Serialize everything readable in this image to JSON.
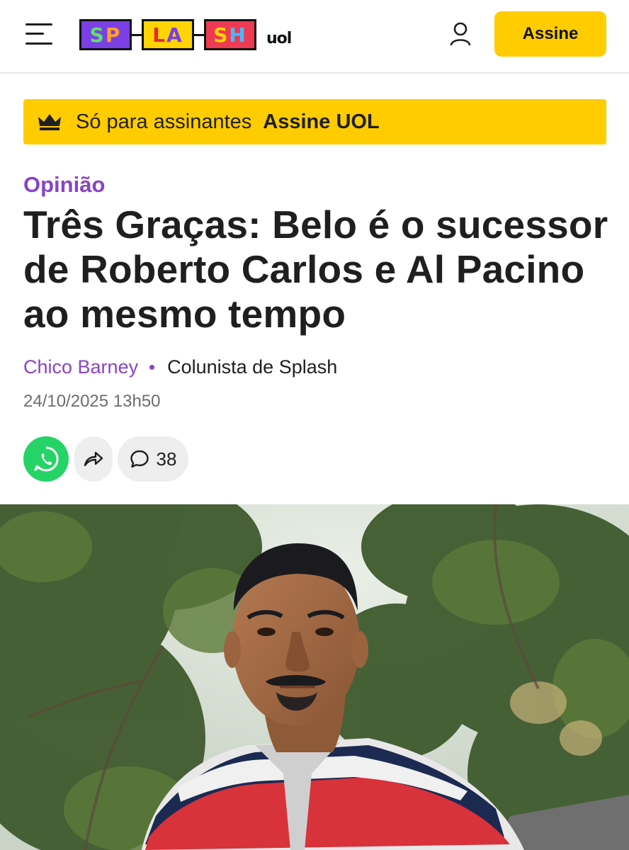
{
  "header": {
    "logo": {
      "letters": [
        "S",
        "P",
        "L",
        "A",
        "S",
        "H"
      ],
      "brand": "uol"
    },
    "subscribe_label": "Assine",
    "menu_icon": "hamburger-menu-icon",
    "user_icon": "user-icon"
  },
  "subscriber_banner": {
    "icon": "crown-icon",
    "text": "Só para assinantes",
    "cta": "Assine UOL"
  },
  "article": {
    "kicker": "Opinião",
    "title": "Três Graças: Belo é o sucessor de Roberto Carlos e Al Pacino ao mesmo tempo",
    "author": "Chico Barney",
    "author_role": "Colunista de Splash",
    "date": "24/10/2025 13h50",
    "actions": {
      "whatsapp_icon": "whatsapp-icon",
      "share_icon": "share-arrow-icon",
      "comment_icon": "comment-bubble-icon",
      "comments_count": "38"
    }
  },
  "colors": {
    "accent_yellow": "#ffcc00",
    "accent_purple": "#8a43c7",
    "whatsapp_green": "#25d366"
  }
}
